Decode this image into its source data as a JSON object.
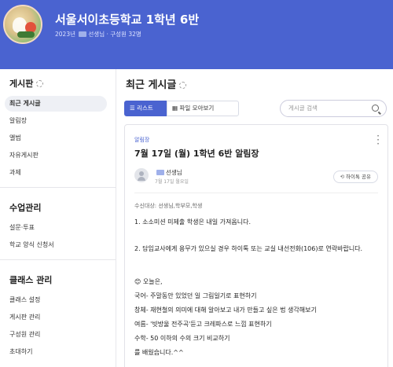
{
  "header": {
    "class_name": "서울서이초등학교 1학년 6반",
    "year": "2023년",
    "teacher": "선생님",
    "member_count": "· 구성원 32명"
  },
  "sidebar": {
    "board_title": "게시판",
    "board_items": [
      "최근 게시글",
      "알림장",
      "앨범",
      "자유게시판",
      "과제"
    ],
    "class_mgmt_title": "수업관리",
    "class_mgmt_items": [
      "설문·투표",
      "학교 양식 신청서"
    ],
    "class_admin_title": "클래스 관리",
    "class_admin_items": [
      "클래스 설정",
      "게시판 관리",
      "구성원 관리",
      "초대하기"
    ]
  },
  "main": {
    "title": "최근 게시글",
    "view_list": "리스트",
    "view_files": "파일 모아보기",
    "search_placeholder": "게시글 검색"
  },
  "post": {
    "category": "알림장",
    "title": "7월 17일 (월) 1학년 6반 알림장",
    "author": "선생님",
    "date": "7월 17일 월요일",
    "share_label": "하이톡 공유",
    "recipients": "수신대상: 선생님,학부모,학생",
    "lines": [
      "1. 소소미션 미제출 학생은 내일 가져옵니다.",
      "2. 담임교사에게 용무가 있으실 경우 하이톡 또는 교실 내선전화(106)로 연락바랍니다.",
      "😊 오늘은,",
      "국어- 주말동안 있었던 일 그림일기로 표현하기",
      "창체- 재현철의 의미에 대해 알아보고 내가 만들고 싶은 법 생각해보기",
      "여름- '빗방울 전주곡'듣고 크레파스로 느낌 표현하기",
      "수학- 50 이하의 수의 크기 비교하기",
      "를 배웠습니다.^^"
    ]
  },
  "colors": {
    "header_bg": "#4a63d0",
    "accent": "#4a63d0"
  }
}
